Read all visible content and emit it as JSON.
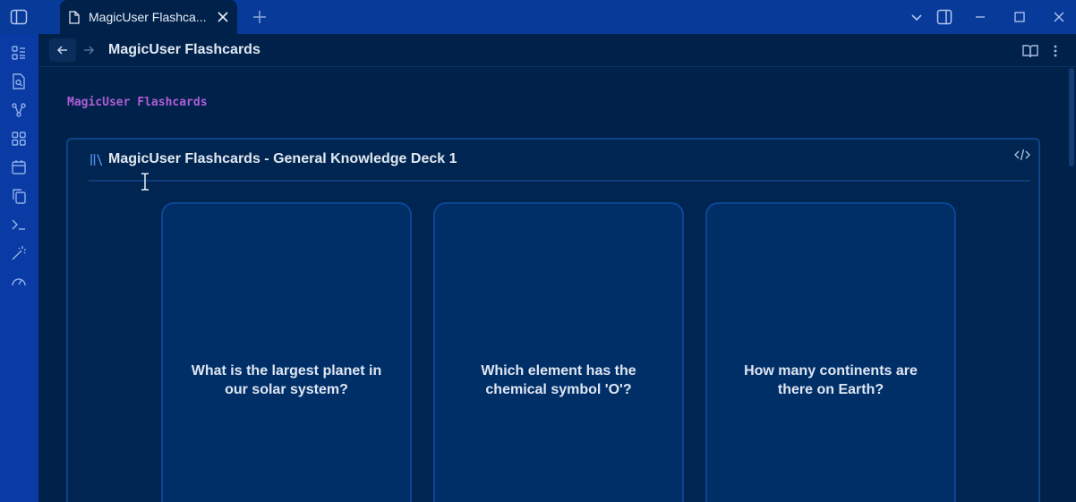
{
  "tab": {
    "title": "MagicUser Flashca..."
  },
  "navbar": {
    "title": "MagicUser Flashcards"
  },
  "editor": {
    "code_line": "MagicUser Flashcards"
  },
  "deck": {
    "title": "MagicUser Flashcards - General Knowledge Deck 1",
    "cards": [
      {
        "question": "What is the largest planet in our solar system?"
      },
      {
        "question": "Which element has the chemical symbol 'O'?"
      },
      {
        "question": "How many continents are there on Earth?"
      }
    ]
  },
  "icons": {
    "ribbon": [
      "files-icon",
      "search-file-icon",
      "graph-icon",
      "grid-icon",
      "calendar-icon",
      "copy-icon",
      "terminal-icon",
      "magic-wand-icon",
      "gauge-icon"
    ]
  },
  "colors": {
    "titlebar": "#083a9a",
    "ribbon": "#0a3aa3",
    "background": "#00224a",
    "card": "#002f68",
    "code_purple": "#b05dd6"
  }
}
